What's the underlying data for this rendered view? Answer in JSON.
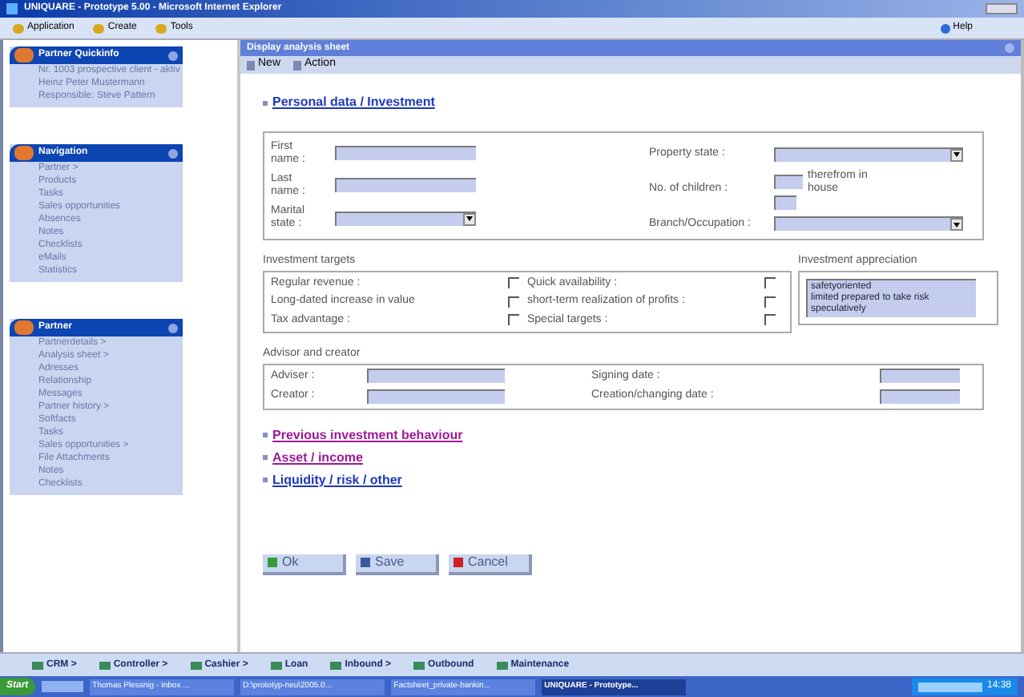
{
  "window": {
    "title": "UNIQUARE - Prototype 5.00 - Microsoft Internet Explorer"
  },
  "menu": [
    "Application",
    "Create",
    "Tools"
  ],
  "help": "Help",
  "sidebar": [
    {
      "title": "Partner Quickinfo",
      "items": [
        "Nr. 1003 prospective client - aktiv",
        "Heinz Peter Mustermann",
        "Responsible: Steve Pattern"
      ]
    },
    {
      "title": "Navigation",
      "items": [
        "Partner >",
        "Products",
        "Tasks",
        "Sales opportunities",
        "Absences",
        "Notes",
        "Checklists",
        "eMails",
        "Statistics"
      ]
    },
    {
      "title": "Partner",
      "items": [
        "Partnerdetails >",
        "Analysis sheet >",
        "Adresses",
        "Relationship",
        "Messages",
        "Partner history >",
        "Softfacts",
        "Tasks",
        "Sales opportunities >",
        "File Attachments",
        "Notes",
        "Checklists"
      ]
    }
  ],
  "content": {
    "title": "Display analysis sheet",
    "toolbar": [
      "New",
      "Action"
    ]
  },
  "section_open": "Personal data / Investment",
  "personal_left": [
    {
      "label": "First name :",
      "kind": "text"
    },
    {
      "label": "Last name :",
      "kind": "text"
    },
    {
      "label": "Marital state :",
      "kind": "select"
    }
  ],
  "personal_right": [
    {
      "label": "Property state :",
      "kind": "select"
    },
    {
      "label": "No. of children :",
      "kind": "children",
      "extra": "therefrom in house"
    },
    {
      "label": "Branch/Occupation :",
      "kind": "select"
    }
  ],
  "targets": {
    "title": "Investment targets",
    "items": [
      {
        "label": "Regular revenue :",
        "checked": false
      },
      {
        "label": "Long-dated increase in value",
        "checked": false
      },
      {
        "label": "Tax advantage :",
        "checked": false
      },
      {
        "label": "Quick availability :",
        "checked": false
      },
      {
        "label": "short-term realization of profits :",
        "checked": false
      },
      {
        "label": "Special targets :",
        "checked": false
      }
    ]
  },
  "appreciation": {
    "title": "Investment appreciation",
    "options": [
      "safetyoriented",
      "limited prepared to take risk",
      "speculatively"
    ]
  },
  "advisor": {
    "title": "Advisor and creator",
    "fields": [
      "Adviser :",
      "Creator :",
      "Signing date :",
      "Creation/changing date :"
    ]
  },
  "sections_closed": [
    {
      "label": "Previous investment behaviour",
      "visited": true
    },
    {
      "label": "Asset / income",
      "visited": true
    },
    {
      "label": "Liquidity / risk / other",
      "visited": false
    }
  ],
  "buttons": [
    {
      "label": "Ok",
      "kind": "ok"
    },
    {
      "label": "Save",
      "kind": "save"
    },
    {
      "label": "Cancel",
      "kind": "cancel"
    }
  ],
  "bottom_nav": [
    "CRM >",
    "Controller >",
    "Cashier >",
    "Loan",
    "Inbound >",
    "Outbound",
    "Maintenance"
  ],
  "taskbar": {
    "start": "Start",
    "tasks": [
      {
        "label": "Thomas Plessnig - Inbox ...",
        "selected": false
      },
      {
        "label": "D:\\prototyp-neu\\2005.0...",
        "selected": false
      },
      {
        "label": "Factsheet_private-bankin...",
        "selected": false
      },
      {
        "label": "UNIQUARE - Prototype...",
        "selected": true
      }
    ],
    "clock": "14:38"
  }
}
